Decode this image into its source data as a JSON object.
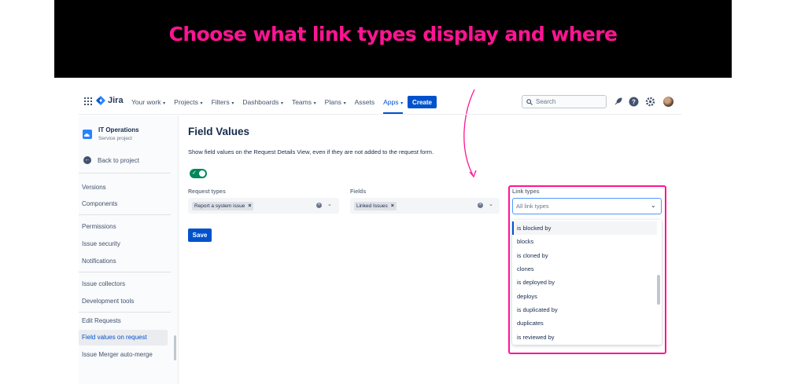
{
  "banner": {
    "title": "Choose what link types display and where"
  },
  "topnav": {
    "logo_text": "Jira",
    "items": [
      {
        "label": "Your work",
        "chevron": true
      },
      {
        "label": "Projects",
        "chevron": true
      },
      {
        "label": "Filters",
        "chevron": true
      },
      {
        "label": "Dashboards",
        "chevron": true
      },
      {
        "label": "Teams",
        "chevron": true
      },
      {
        "label": "Plans",
        "chevron": true
      },
      {
        "label": "Assets",
        "chevron": false
      },
      {
        "label": "Apps",
        "chevron": true,
        "active": true
      }
    ],
    "create_label": "Create",
    "search_placeholder": "Search",
    "icons": [
      "notifications-icon",
      "help-icon",
      "settings-icon",
      "avatar"
    ]
  },
  "sidebar": {
    "project_name": "IT Operations",
    "project_type": "Service project",
    "back_label": "Back to project",
    "items": [
      "Versions",
      "Components",
      "Permissions",
      "Issue security",
      "Notifications",
      "Issue collectors",
      "Development tools",
      "Edit Requests",
      "Field values on request",
      "Issue Merger auto-merge"
    ],
    "active_item": "Field values on request"
  },
  "main": {
    "title": "Field Values",
    "description": "Show field values on the Request Details View, even if they are not added to the request form.",
    "toggle_on": true,
    "request_types": {
      "label": "Request types",
      "chips": [
        "Report a system issue"
      ]
    },
    "fields": {
      "label": "Fields",
      "chips": [
        "Linked Issues"
      ]
    },
    "link_types": {
      "label": "Link types",
      "placeholder": "All link types",
      "options": [
        "is blocked by",
        "blocks",
        "is cloned by",
        "clones",
        "is deployed by",
        "deploys",
        "is duplicated by",
        "duplicates",
        "is reviewed by"
      ],
      "highlighted_option": "is blocked by"
    },
    "save_label": "Save"
  },
  "colors": {
    "accent": "#0052cc",
    "highlight": "#ff1493",
    "toggle_on": "#00875a",
    "banner_bg": "#000000"
  }
}
